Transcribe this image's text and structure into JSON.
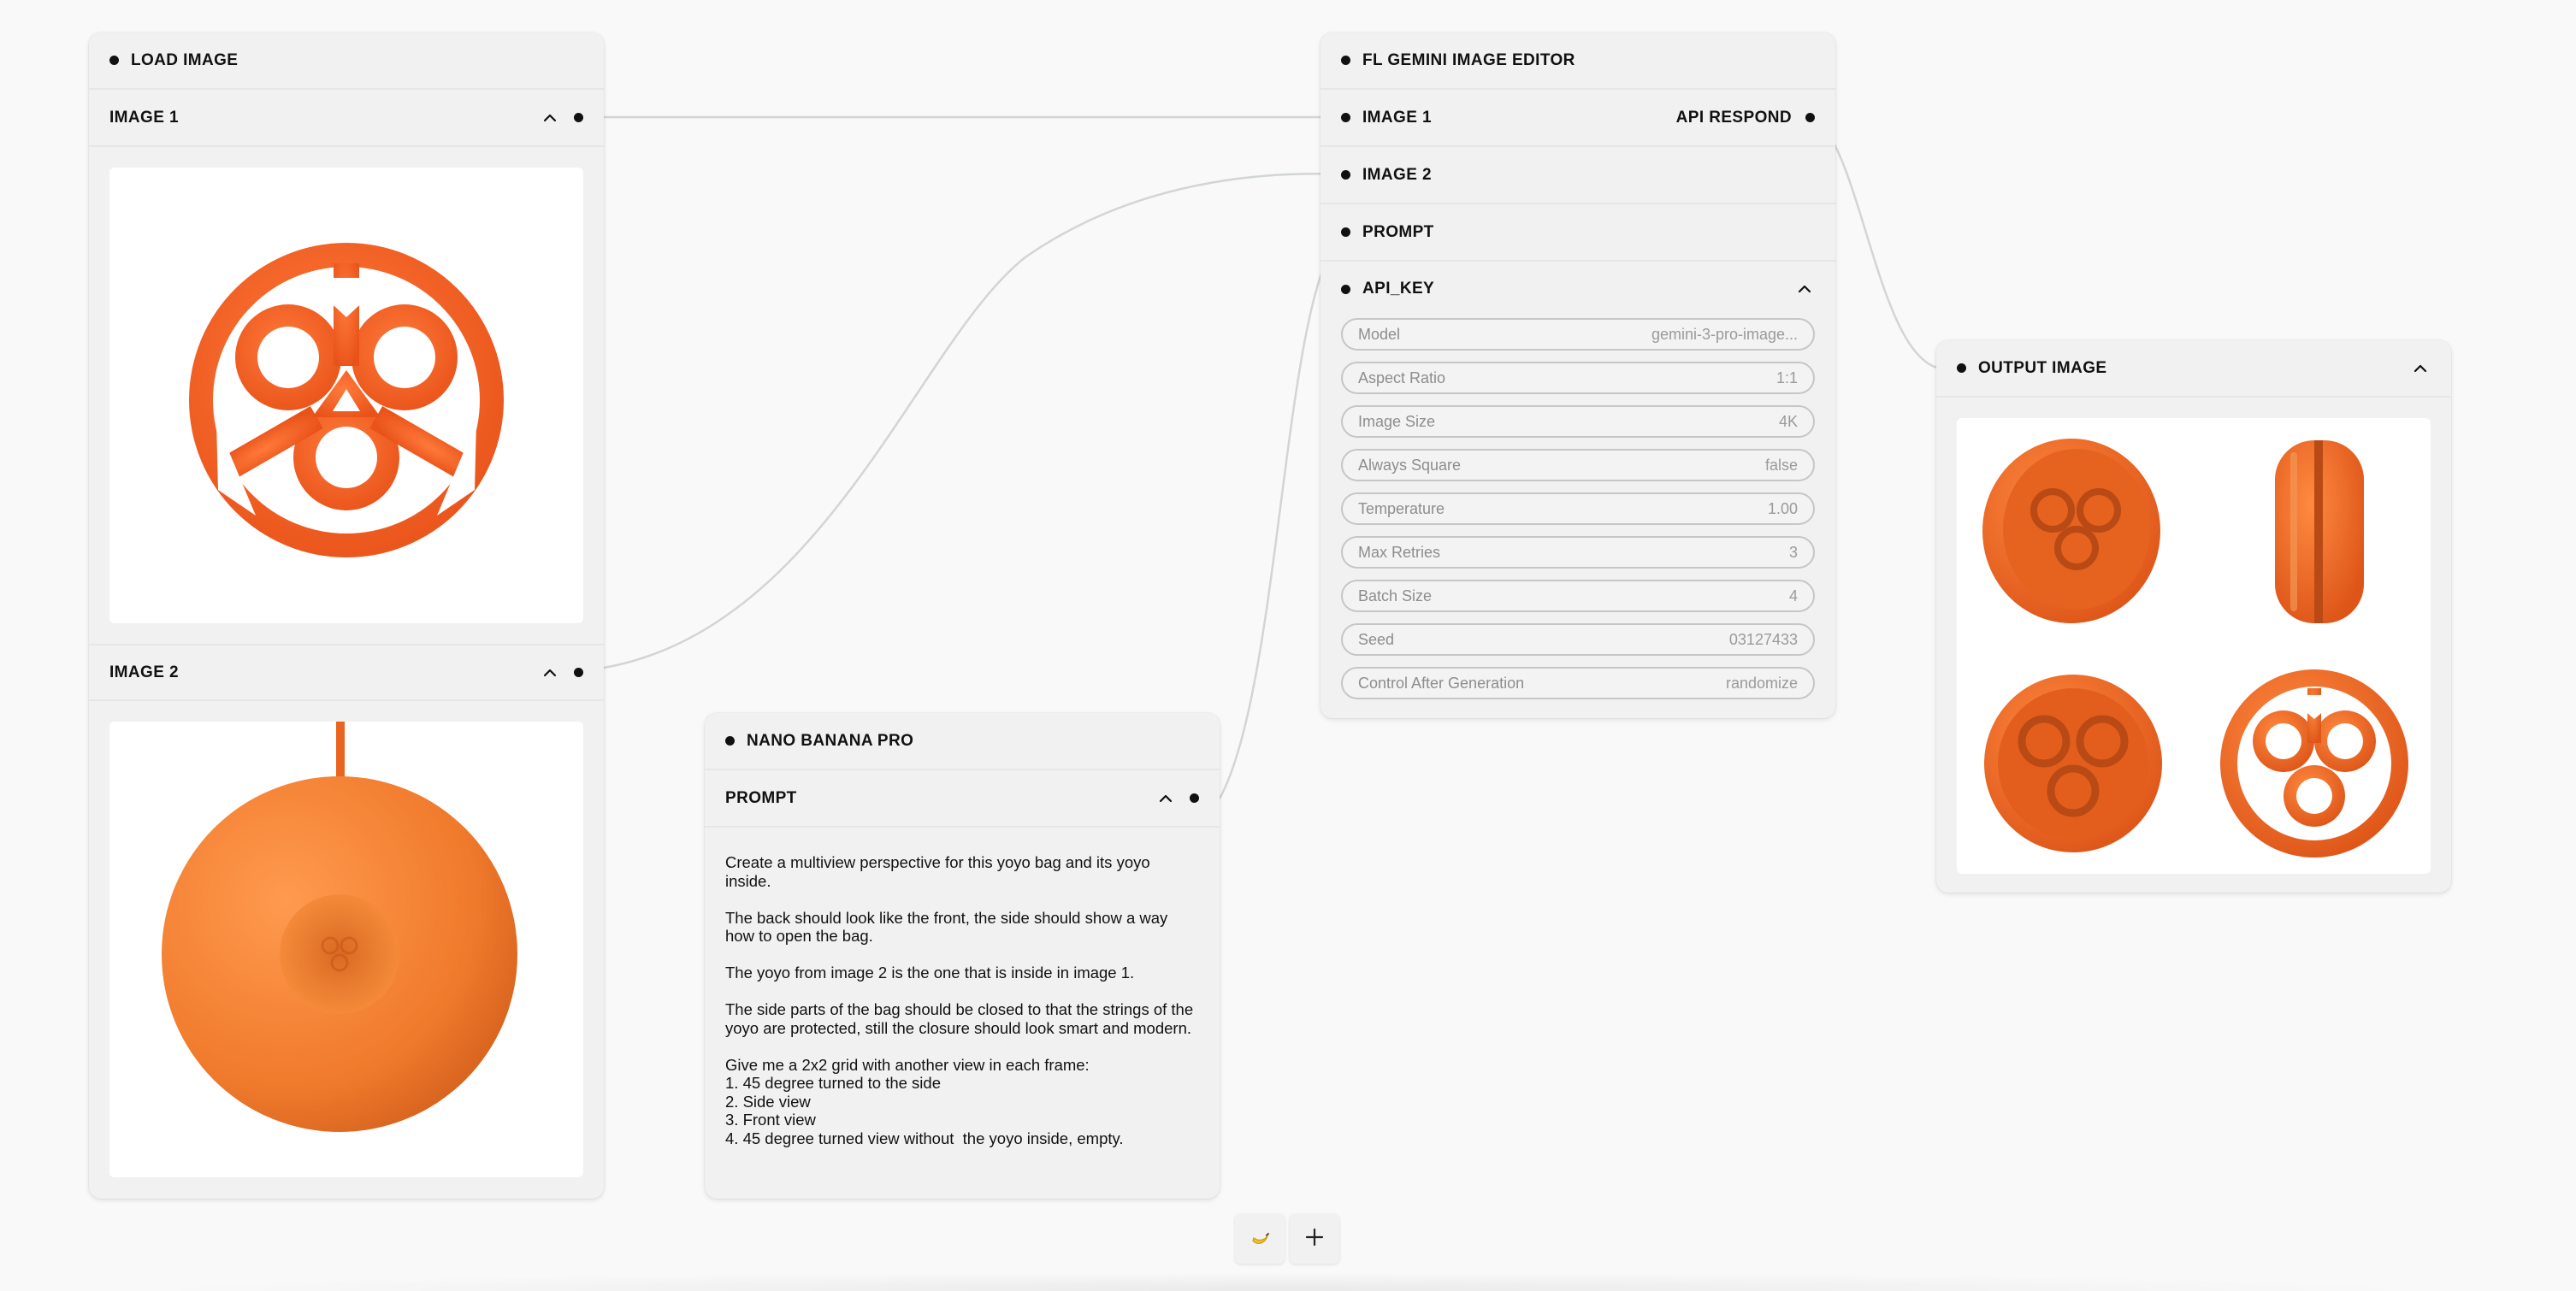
{
  "load_image_node": {
    "title": "LOAD IMAGE",
    "image1_label": "IMAGE 1",
    "image2_label": "IMAGE 2"
  },
  "nano_node": {
    "title": "NANO BANANA PRO",
    "prompt_label": "PROMPT",
    "prompt_text": "Create a multiview perspective for this yoyo bag and its yoyo inside.\n\nThe back should look like the front, the side should show a way how to open the bag.\n\nThe yoyo from image 2 is the one that is inside in image 1.\n\nThe side parts of the bag should be closed to that the strings of the yoyo are protected, still the closure should look smart and modern.\n\nGive me a 2x2 grid with another view in each frame:\n1. 45 degree turned to the side\n2. Side view\n3. Front view\n4. 45 degree turned view without  the yoyo inside, empty."
  },
  "gemini_node": {
    "title": "FL GEMINI IMAGE EDITOR",
    "inputs": {
      "image1": "IMAGE 1",
      "image2": "IMAGE 2",
      "prompt": "PROMPT",
      "api_key": "API_KEY"
    },
    "output_label": "API RESPOND",
    "fields": [
      {
        "label": "Model",
        "value": "gemini-3-pro-image..."
      },
      {
        "label": "Aspect Ratio",
        "value": "1:1"
      },
      {
        "label": "Image Size",
        "value": "4K"
      },
      {
        "label": "Always Square",
        "value": "false"
      },
      {
        "label": "Temperature",
        "value": "1.00"
      },
      {
        "label": "Max Retries",
        "value": "3"
      },
      {
        "label": "Batch Size",
        "value": "4"
      },
      {
        "label": "Seed",
        "value": "03127433"
      },
      {
        "label": "Control After Generation",
        "value": "randomize"
      }
    ]
  },
  "output_node": {
    "title": "OUTPUT IMAGE"
  },
  "colors": {
    "accent_orange": "#f05a1e",
    "canvas_bg": "#f8f9f8",
    "node_bg": "#f1f1f1",
    "wire": "#d2d6d2"
  },
  "toolbar": {
    "items": [
      "banana-icon",
      "plus-icon"
    ]
  }
}
